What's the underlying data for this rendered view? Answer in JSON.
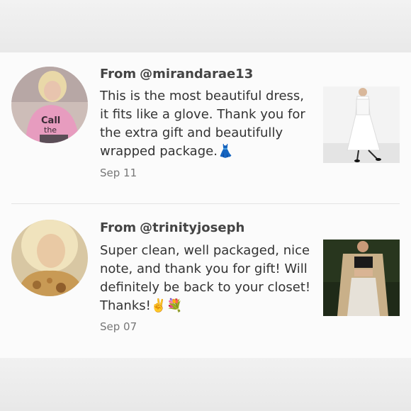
{
  "reviews": [
    {
      "from_prefix": "From",
      "username": "@mirandarae13",
      "text": "This is the most beautiful dress, it fits like a glove. Thank you for the extra gift and beautifully wrapped package.👗",
      "date": "Sep 11"
    },
    {
      "from_prefix": "From",
      "username": "@trinityjoseph",
      "text": "Super clean, well packaged, nice note, and thank you for gift! Will definitely be back to your closet! Thanks!✌️💐",
      "date": "Sep 07"
    }
  ],
  "colors": {
    "text": "#333333",
    "username": "#444444",
    "date": "#777777",
    "panel": "#fbfbfb",
    "divider": "#e3e3e3"
  }
}
